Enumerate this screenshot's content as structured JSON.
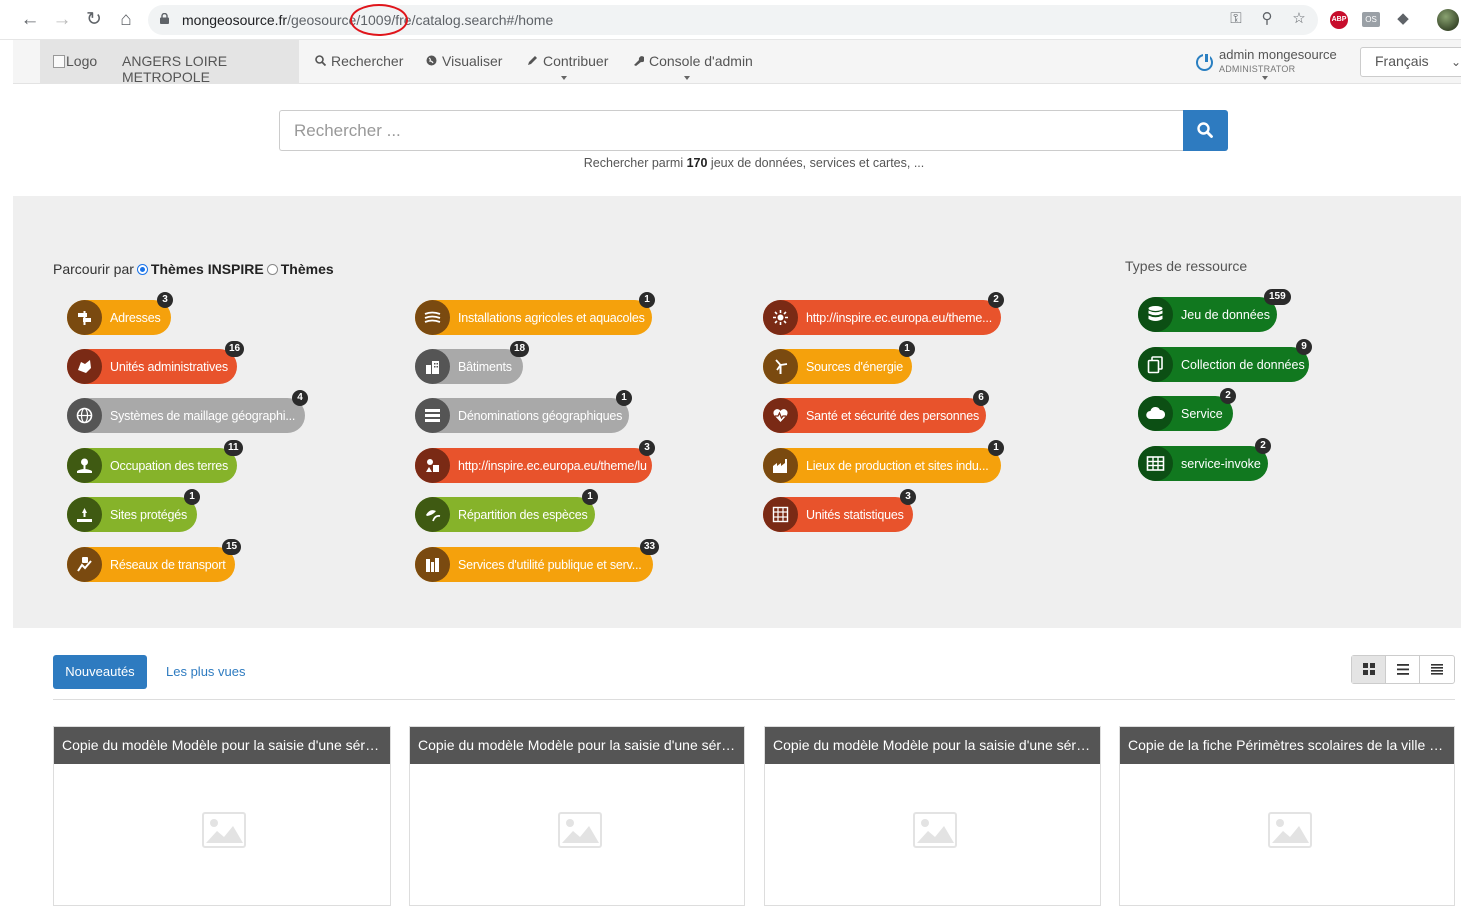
{
  "browser": {
    "url_host": "mongeosource.fr",
    "url_path": "/geosource/1009/fre/catalog.search#/home"
  },
  "header": {
    "logo_alt": "Logo",
    "org_name": "ANGERS LOIRE METROPOLE",
    "menu": [
      {
        "label": "Rechercher",
        "icon": "search-icon"
      },
      {
        "label": "Visualiser",
        "icon": "globe-icon"
      },
      {
        "label": "Contribuer",
        "icon": "pencil-icon"
      },
      {
        "label": "Console d'admin",
        "icon": "wrench-icon"
      }
    ],
    "user_name": "admin mongesource",
    "user_role": "ADMINISTRATOR",
    "language": "Français"
  },
  "search": {
    "placeholder": "Rechercher ...",
    "hint_prefix": "Rechercher parmi ",
    "hint_count": "170",
    "hint_suffix": " jeux de données, services et cartes, ..."
  },
  "browse": {
    "label": "Parcourir par",
    "option_inspire": "Thèmes INSPIRE",
    "option_themes": "Thèmes",
    "selected": "Thèmes INSPIRE",
    "types_title": "Types de ressource",
    "themes": [
      {
        "label": "Adresses",
        "count": "3",
        "color": "#f5a10c",
        "icon_bg": "#7a4a10"
      },
      {
        "label": "Unités administratives",
        "count": "16",
        "color": "#e8532c",
        "icon_bg": "#7a2a15"
      },
      {
        "label": "Systèmes de maillage géographi...",
        "count": "4",
        "color": "#a9a9a9",
        "icon_bg": "#555555"
      },
      {
        "label": "Occupation des terres",
        "count": "11",
        "color": "#86b32a",
        "icon_bg": "#3f5a12"
      },
      {
        "label": "Sites protégés",
        "count": "1",
        "color": "#86b32a",
        "icon_bg": "#3f5a12"
      },
      {
        "label": "Réseaux de transport",
        "count": "15",
        "color": "#f5a10c",
        "icon_bg": "#7a4a10"
      },
      {
        "label": "Installations agricoles et aquacoles",
        "count": "1",
        "color": "#f5a10c",
        "icon_bg": "#7a4a10"
      },
      {
        "label": "Bâtiments",
        "count": "18",
        "color": "#a9a9a9",
        "icon_bg": "#555555"
      },
      {
        "label": "Dénominations géographiques",
        "count": "1",
        "color": "#a9a9a9",
        "icon_bg": "#555555"
      },
      {
        "label": "http://inspire.ec.europa.eu/theme/lu",
        "count": "3",
        "color": "#e8532c",
        "icon_bg": "#7a2a15"
      },
      {
        "label": "Répartition des espèces",
        "count": "1",
        "color": "#86b32a",
        "icon_bg": "#3f5a12"
      },
      {
        "label": "Services d'utilité publique et serv...",
        "count": "33",
        "color": "#f5a10c",
        "icon_bg": "#7a4a10"
      },
      {
        "label": "http://inspire.ec.europa.eu/theme...",
        "count": "2",
        "color": "#e8532c",
        "icon_bg": "#7a2a15"
      },
      {
        "label": "Sources d'énergie",
        "count": "1",
        "color": "#f5a10c",
        "icon_bg": "#7a4a10"
      },
      {
        "label": "Santé et sécurité des personnes",
        "count": "6",
        "color": "#e8532c",
        "icon_bg": "#7a2a15"
      },
      {
        "label": "Lieux de production et sites indu...",
        "count": "1",
        "color": "#f5a10c",
        "icon_bg": "#7a4a10"
      },
      {
        "label": "Unités statistiques",
        "count": "3",
        "color": "#e8532c",
        "icon_bg": "#7a2a15"
      }
    ],
    "resource_types": [
      {
        "label": "Jeu de données",
        "count": "159",
        "icon": "database-icon"
      },
      {
        "label": "Collection de données",
        "count": "9",
        "icon": "copy-icon"
      },
      {
        "label": "Service",
        "count": "2",
        "icon": "cloud-icon"
      },
      {
        "label": "service-invoke",
        "count": "2",
        "icon": "table-icon"
      }
    ]
  },
  "tabs": {
    "active": "Nouveautés",
    "other": "Les plus vues"
  },
  "cards": [
    {
      "title": "Copie du modèle Modèle pour la saisie d'une série..."
    },
    {
      "title": "Copie du modèle Modèle pour la saisie d'une série..."
    },
    {
      "title": "Copie du modèle Modèle pour la saisie d'une série..."
    },
    {
      "title": "Copie de la fiche Périmètres scolaires de la ville d'..."
    }
  ]
}
